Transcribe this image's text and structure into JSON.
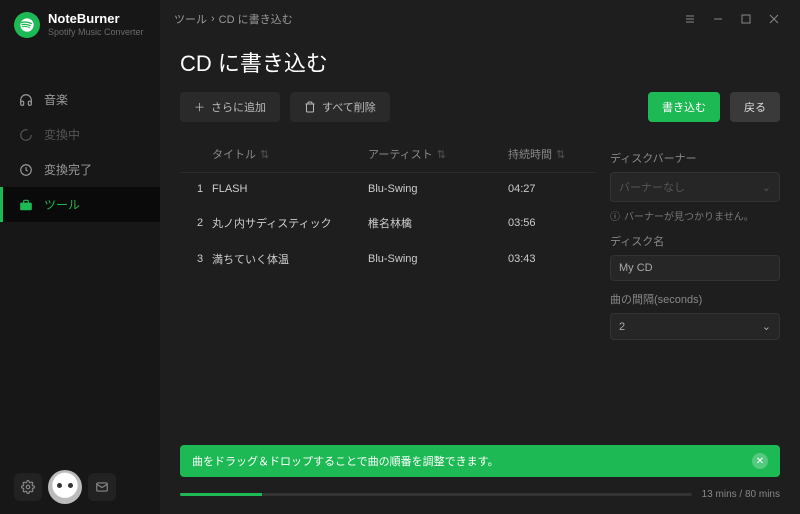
{
  "brand": {
    "title": "NoteBurner",
    "subtitle": "Spotify Music Converter"
  },
  "nav": {
    "items": [
      {
        "label": "音楽"
      },
      {
        "label": "変換中"
      },
      {
        "label": "変換完了"
      },
      {
        "label": "ツール"
      }
    ]
  },
  "breadcrumb": {
    "root": "ツール",
    "current": "CD に書き込む"
  },
  "page_title": "CD に書き込む",
  "toolbar": {
    "add_label": "さらに追加",
    "clear_label": "すべて削除",
    "burn_label": "書き込む",
    "back_label": "戻る"
  },
  "table": {
    "headers": {
      "title": "タイトル",
      "artist": "アーティスト",
      "duration": "持続時間"
    },
    "rows": [
      {
        "n": "1",
        "title": "FLASH",
        "artist": "Blu-Swing",
        "duration": "04:27"
      },
      {
        "n": "2",
        "title": "丸ノ内サディスティック",
        "artist": "椎名林檎",
        "duration": "03:56"
      },
      {
        "n": "3",
        "title": "満ちていく体温",
        "artist": "Blu-Swing",
        "duration": "03:43"
      }
    ]
  },
  "panel": {
    "burner_label": "ディスクバーナー",
    "burner_value": "バーナーなし",
    "burner_warn": "バーナーが見つかりません。",
    "disc_label": "ディスク名",
    "disc_value": "My CD",
    "gap_label": "曲の間隔(seconds)",
    "gap_value": "2"
  },
  "toast": "曲をドラッグ＆ドロップすることで曲の順番を調整できます。",
  "progress": {
    "text": "13 mins / 80 mins",
    "percent": 16
  }
}
